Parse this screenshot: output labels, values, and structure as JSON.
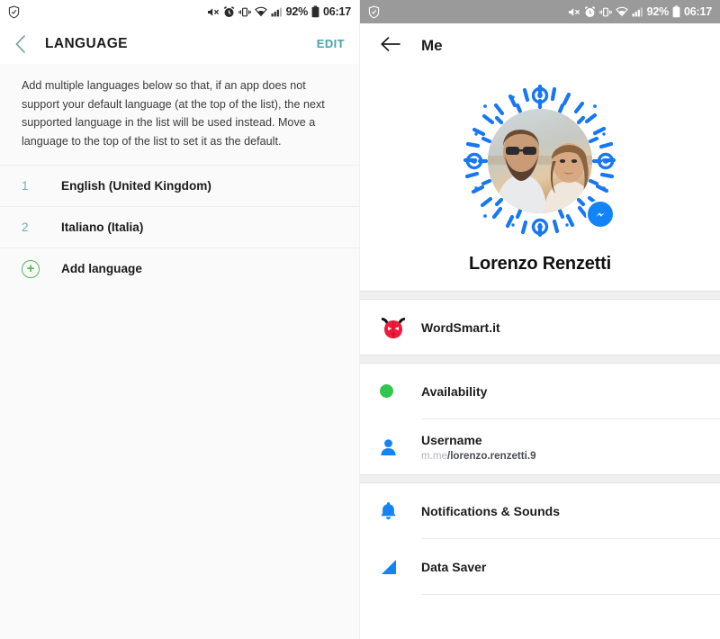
{
  "left_panel": {
    "statusbar": {
      "left_icons": [
        "shield-check-icon"
      ],
      "right_icons": [
        "mute-icon",
        "alarm-icon",
        "vibrate-icon",
        "wifi-icon",
        "signal-icon",
        "battery-icon"
      ],
      "battery_text": "92%",
      "clock": "06:17"
    },
    "appbar": {
      "back_icon": "back-chevron-icon",
      "title": "LANGUAGE",
      "edit_label": "EDIT",
      "edit_color": "#4ba3a3"
    },
    "description": "Add multiple languages below so that, if an app does not support your default language (at the top of the list), the next supported language in the list will be used instead. Move a language to the top of the list to set it as the default.",
    "languages": [
      {
        "index": "1",
        "name": "English (United Kingdom)"
      },
      {
        "index": "2",
        "name": "Italiano (Italia)"
      }
    ],
    "add_language": {
      "icon": "plus-circle-icon",
      "label": "Add language",
      "color": "#4fba52"
    }
  },
  "right_panel": {
    "statusbar": {
      "left_icons": [
        "shield-check-icon"
      ],
      "right_icons": [
        "mute-icon",
        "alarm-icon",
        "vibrate-icon",
        "wifi-icon",
        "signal-icon",
        "battery-icon"
      ],
      "battery_text": "92%",
      "clock": "06:17",
      "background": "#9a9a9a"
    },
    "appbar": {
      "back_icon": "back-arrow-icon",
      "title": "Me"
    },
    "profile": {
      "avatar_alt": "profile-photo-couple",
      "messenger_code_color": "#1877f2",
      "badge_icon": "messenger-logo-icon",
      "name": "Lorenzo Renzetti"
    },
    "page_section": [
      {
        "icon": "wordsmart-devil-icon",
        "label": "WordSmart.it"
      }
    ],
    "account_section": [
      {
        "icon": "availability-dot-icon",
        "label": "Availability",
        "icon_color": "#31c74e"
      },
      {
        "icon": "person-icon",
        "label": "Username",
        "sub_dim": "m.me",
        "sub_strong": "/lorenzo.renzetti.9",
        "icon_color": "#1384f5"
      }
    ],
    "settings_section": [
      {
        "icon": "bell-icon",
        "label": "Notifications & Sounds",
        "icon_color": "#1384f5"
      },
      {
        "icon": "data-saver-icon",
        "label": "Data Saver",
        "icon_color": "#1384f5"
      }
    ]
  }
}
